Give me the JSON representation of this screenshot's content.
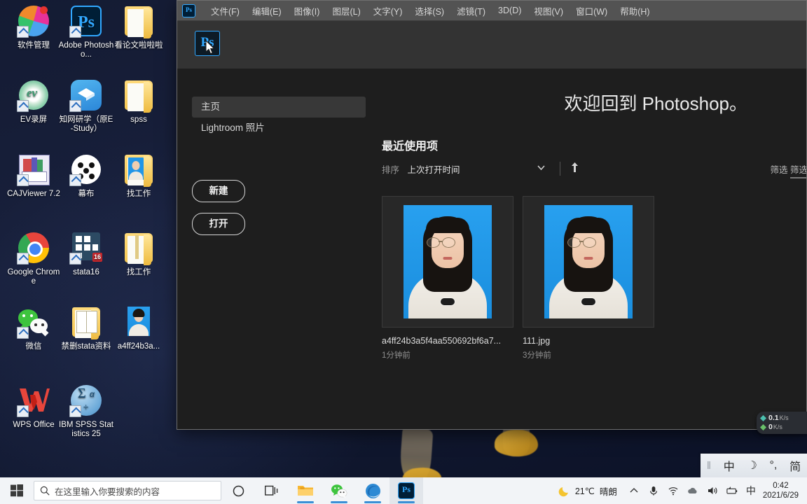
{
  "desktop": {
    "icons": [
      {
        "label": "软件管理",
        "icon": "software-manager-icon"
      },
      {
        "label": "Adobe Photosho...",
        "icon": "adobe-photoshop-icon"
      },
      {
        "label": "看论文啦啦啦",
        "icon": "folder-icon"
      },
      {
        "label": "EV录屏",
        "icon": "ev-recorder-icon"
      },
      {
        "label": "知网研学（原E-Study）",
        "icon": "cnki-estudy-icon"
      },
      {
        "label": "spss",
        "icon": "folder-icon"
      },
      {
        "label": "CAJViewer 7.2",
        "icon": "cajviewer-icon"
      },
      {
        "label": "幕布",
        "icon": "mubu-icon"
      },
      {
        "label": "找工作",
        "icon": "folder-photo-icon"
      },
      {
        "label": "Google Chrome",
        "icon": "google-chrome-icon"
      },
      {
        "label": "stata16",
        "icon": "stata16-icon"
      },
      {
        "label": "找工作",
        "icon": "folder-zip-icon"
      },
      {
        "label": "微信",
        "icon": "wechat-icon"
      },
      {
        "label": "禁删stata资料",
        "icon": "folder-docs-icon"
      },
      {
        "label": "a4ff24b3a...",
        "icon": "image-file-icon"
      },
      {
        "label": "WPS Office",
        "icon": "wps-office-icon"
      },
      {
        "label": "IBM SPSS Statistics 25",
        "icon": "ibm-spss-icon"
      }
    ]
  },
  "photoshop": {
    "app_badge": "Ps",
    "menu": [
      {
        "label": "文件(F)"
      },
      {
        "label": "编辑(E)"
      },
      {
        "label": "图像(I)"
      },
      {
        "label": "图层(L)"
      },
      {
        "label": "文字(Y)"
      },
      {
        "label": "选择(S)"
      },
      {
        "label": "滤镜(T)"
      },
      {
        "label": "3D(D)"
      },
      {
        "label": "视图(V)"
      },
      {
        "label": "窗口(W)"
      },
      {
        "label": "帮助(H)"
      }
    ],
    "tab_icon_label": "Ps",
    "home": {
      "rail": [
        {
          "label": "主页",
          "active": true
        },
        {
          "label": "Lightroom 照片",
          "active": false
        }
      ],
      "new_button": "新建",
      "open_button": "打开",
      "welcome": "欢迎回到 Photoshop。",
      "recent_title": "最近使用项",
      "sort_label": "排序",
      "sort_value": "上次打开时间",
      "sort_dropdown_icon": "chevron-down-icon",
      "sort_direction_icon": "arrow-up-icon",
      "filter_label_1": "筛选",
      "filter_label_2": "筛选",
      "recent_items": [
        {
          "name": "a4ff24b3a5f4aa550692bf6a7...",
          "time": "1分钟前",
          "thumb": "id-photo-blue"
        },
        {
          "name": "111.jpg",
          "time": "3分钟前",
          "thumb": "id-photo-blue"
        }
      ]
    }
  },
  "netspeed": {
    "up_value": "0.1",
    "up_unit": "K/s",
    "down_value": "0",
    "down_unit": "K/s"
  },
  "ime_bar": {
    "grip": "‖",
    "mode": "中",
    "moon_icon": "moon-icon",
    "punct": "°,",
    "script": "简"
  },
  "taskbar": {
    "start_icon": "windows-start-icon",
    "search_icon": "search-icon",
    "search_placeholder": "在这里输入你要搜索的内容",
    "cortana_icon": "cortana-circle-icon",
    "taskview_icon": "task-view-icon",
    "apps": [
      {
        "icon": "file-explorer-icon",
        "name": "file-explorer",
        "open": true,
        "active": false
      },
      {
        "icon": "wechat-icon",
        "name": "wechat",
        "open": true,
        "active": false
      },
      {
        "icon": "edge-browser-icon",
        "name": "edge-browser",
        "open": true,
        "active": false
      },
      {
        "icon": "photoshop-icon",
        "name": "photoshop",
        "open": true,
        "active": true
      }
    ],
    "tray": {
      "weather_icon": "weather-sunny-icon",
      "temperature": "21℃",
      "condition": "晴朗",
      "overflow_icon": "chevron-up-icon",
      "mic_icon": "microphone-icon",
      "wifi_icon": "wifi-icon",
      "onedrive_icon": "onedrive-cloud-icon",
      "volume_icon": "speaker-icon",
      "battery_icon": "battery-icon",
      "ime_indicator": "中",
      "time": "0:42",
      "date": "2021/6/29"
    }
  }
}
